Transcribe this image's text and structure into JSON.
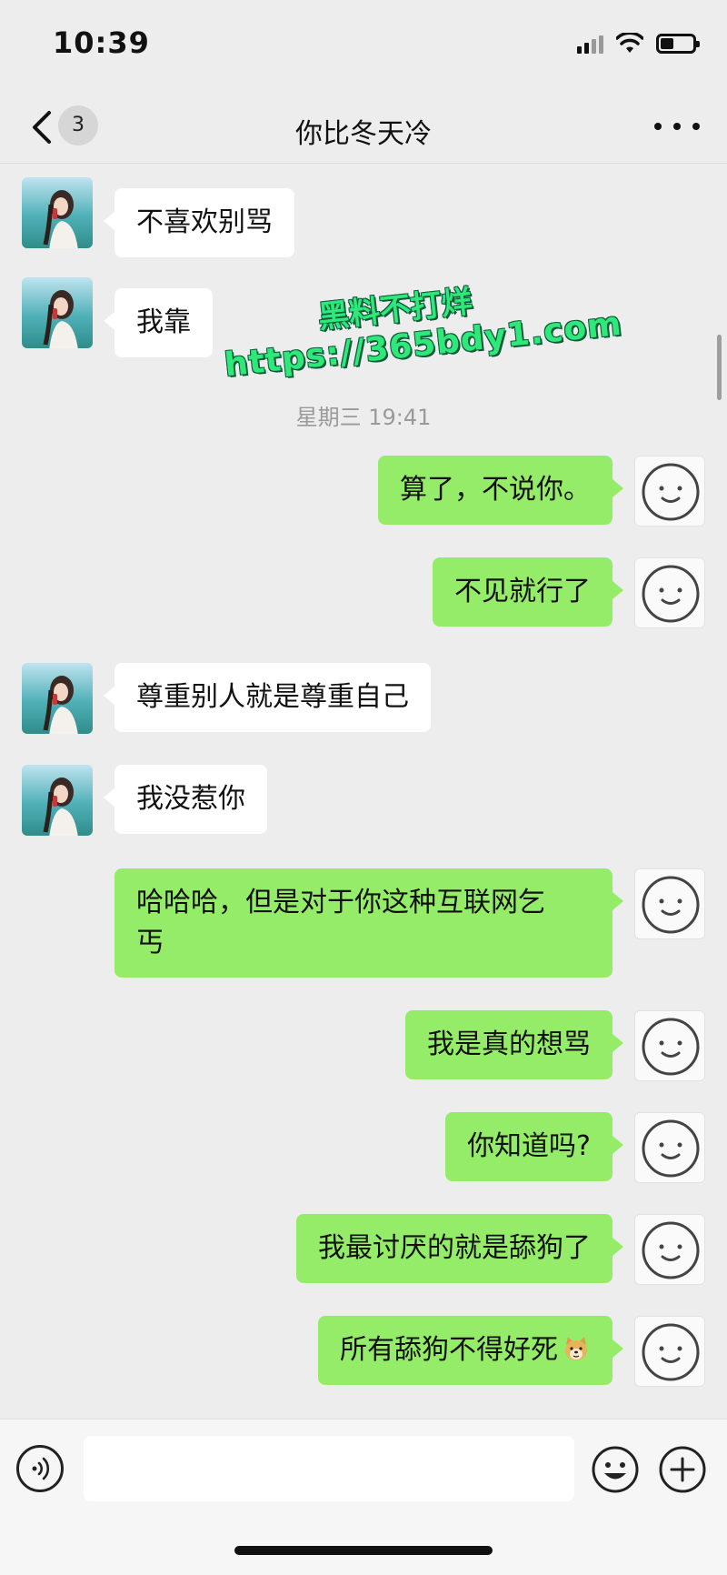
{
  "status_bar": {
    "time": "10:39",
    "battery_level": 0.4
  },
  "nav": {
    "unread_count": "3",
    "title": "你比冬天冷",
    "back_icon": "chevron-left-icon",
    "more_icon": "more-dots-icon"
  },
  "chat": {
    "timestamp": "星期三 19:41",
    "messages": [
      {
        "side": "left",
        "text": "不喜欢别骂"
      },
      {
        "side": "left",
        "text": "我靠"
      },
      {
        "side": "right",
        "text": "算了，不说你。"
      },
      {
        "side": "right",
        "text": "不见就行了"
      },
      {
        "side": "left",
        "text": "尊重别人就是尊重自己"
      },
      {
        "side": "left",
        "text": "我没惹你"
      },
      {
        "side": "right",
        "text": "哈哈哈，但是对于你这种互联网乞",
        "text_line2": "丐"
      },
      {
        "side": "right",
        "text": "我是真的想骂"
      },
      {
        "side": "right",
        "text": "你知道吗?"
      },
      {
        "side": "right",
        "text": "我最讨厌的就是舔狗了"
      },
      {
        "side": "right",
        "text": "所有舔狗不得好死",
        "emoji": "doge-emoji"
      }
    ]
  },
  "watermark": {
    "line1": "黑料不打烊",
    "line2": "https://365bdy1.com"
  },
  "input_bar": {
    "voice_icon": "voice-icon",
    "emoji_icon": "smiley-icon",
    "plus_icon": "plus-circle-icon",
    "placeholder": ""
  },
  "colors": {
    "my_bubble": "#95ec69",
    "their_bubble": "#ffffff",
    "background": "#ededed",
    "watermark": "#2ee87a"
  }
}
